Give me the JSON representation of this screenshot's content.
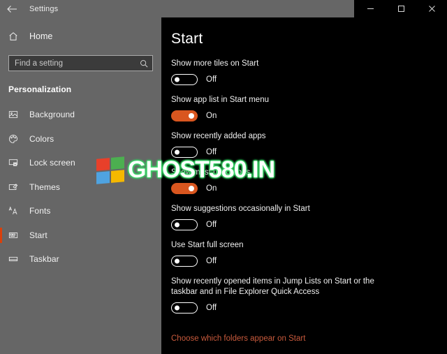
{
  "window": {
    "title": "Settings",
    "back_icon": "back-arrow-icon",
    "controls": [
      {
        "name": "minimize-button",
        "glyph": "minimize-icon"
      },
      {
        "name": "maximize-button",
        "glyph": "maximize-icon"
      },
      {
        "name": "close-button",
        "glyph": "close-icon"
      }
    ]
  },
  "sidebar": {
    "home": {
      "label": "Home",
      "icon": "home-icon"
    },
    "search": {
      "placeholder": "Find a setting",
      "value": "",
      "icon": "search-icon"
    },
    "section_title": "Personalization",
    "items": [
      {
        "label": "Background",
        "icon": "image-icon",
        "active": false
      },
      {
        "label": "Colors",
        "icon": "palette-icon",
        "active": false
      },
      {
        "label": "Lock screen",
        "icon": "lock-screen-icon",
        "active": false
      },
      {
        "label": "Themes",
        "icon": "themes-brush-icon",
        "active": false
      },
      {
        "label": "Fonts",
        "icon": "fonts-icon",
        "active": false
      },
      {
        "label": "Start",
        "icon": "start-tiles-icon",
        "active": true
      },
      {
        "label": "Taskbar",
        "icon": "taskbar-icon",
        "active": false
      }
    ]
  },
  "main": {
    "title": "Start",
    "settings": [
      {
        "label": "Show more tiles on Start",
        "state": "Off",
        "on": false
      },
      {
        "label": "Show app list in Start menu",
        "state": "On",
        "on": true
      },
      {
        "label": "Show recently added apps",
        "state": "Off",
        "on": false
      },
      {
        "label": "Show most used apps",
        "state": "On",
        "on": true
      },
      {
        "label": "Show suggestions occasionally in Start",
        "state": "Off",
        "on": false
      },
      {
        "label": "Use Start full screen",
        "state": "Off",
        "on": false
      },
      {
        "label": "Show recently opened items in Jump Lists on Start or the taskbar and in File Explorer Quick Access",
        "state": "Off",
        "on": false
      }
    ],
    "link": "Choose which folders appear on Start"
  },
  "watermark": {
    "text": "GHOST580.IN",
    "logo_colors": [
      "#e8402a",
      "#4caf50",
      "#4fa3e0",
      "#f5b800"
    ]
  },
  "colors": {
    "accent": "#d9561f",
    "link": "#c85a3c",
    "sidebar_bg": "#666666",
    "main_bg": "#000000",
    "active_bar": "#d9400b"
  }
}
